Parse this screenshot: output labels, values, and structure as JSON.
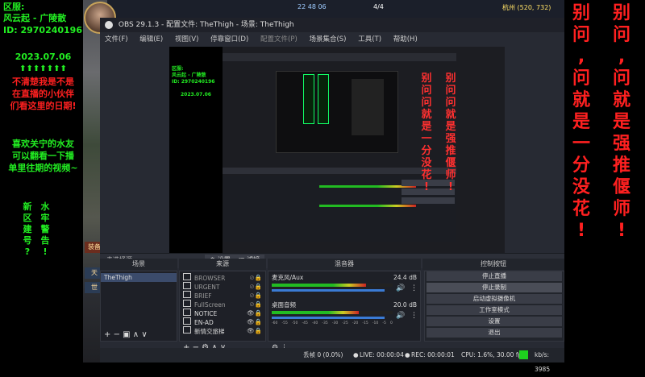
{
  "left_overlay": {
    "line1": "区服:",
    "line2": "风云起 - 广陵散",
    "line3": "ID: 2970240196",
    "date": "2023.07.06",
    "arrows": "⬆⬆⬆⬆⬆⬆⬆",
    "notice": [
      "不清楚我是不是",
      "在直播的小伙伴",
      "们看这里的日期!"
    ],
    "promo": [
      "喜欢关宁的水友",
      "可以翻看一下播",
      "单里往期的视频~"
    ],
    "vcol1": [
      "新",
      "区",
      "建",
      "号",
      "?"
    ],
    "vcol2": [
      "水",
      "牢",
      "警",
      "告",
      "!"
    ]
  },
  "game_top": {
    "time": "22 48 06",
    "count": "4/4",
    "location": "杭州 (520, 732)"
  },
  "obs": {
    "title": "OBS 29.1.3 - 配置文件: TheThigh - 场景: TheThigh",
    "menu": [
      "文件(F)",
      "编辑(E)",
      "视图(V)",
      "停靠窗口(D)",
      "配置文件(P)",
      "场景集合(S)",
      "工具(T)",
      "帮助(H)"
    ],
    "no_source": "未选择源",
    "props_label": "设置",
    "filters_label": "滤镜",
    "docks": {
      "scenes": "场景",
      "sources": "来源",
      "mixer": "混音器",
      "controls": "控制按钮"
    },
    "scenes": [
      "TheThigh"
    ],
    "sources": [
      "BROWSER",
      "URGENT",
      "BRIEF",
      "FullScreen",
      "NOTICE",
      "EN-AD",
      "新情交旅梯"
    ],
    "mixer": [
      {
        "name": "麦克风/Aux",
        "db": "24.4 dB",
        "level": 0.78
      },
      {
        "name": "桌面音频",
        "db": "20.0 dB",
        "level": 0.72
      }
    ],
    "mixer_scale": [
      "-60",
      "-55",
      "-50",
      "-45",
      "-40",
      "-35",
      "-30",
      "-25",
      "-20",
      "-15",
      "-10",
      "-5",
      "0"
    ],
    "controls": [
      "停止直播",
      "停止录制",
      "启动虚拟摄像机",
      "工作室模式",
      "设置",
      "退出"
    ],
    "status": {
      "dropped": "丢帧 0 (0.0%)",
      "live": "LIVE: 00:00:04",
      "rec": "REC: 00:00:01",
      "cpu": "CPU: 1.6%, 30.00 fps",
      "kbps": "kb/s: 3985"
    }
  },
  "game_side_labels": [
    "装备",
    "天",
    "世"
  ],
  "right_overlay": {
    "col1": [
      "别",
      "问",
      ",",
      "问",
      "就",
      "是",
      "一",
      "分",
      "没",
      "花",
      "!"
    ],
    "col2": [
      "别",
      "问",
      ",",
      "问",
      "就",
      "是",
      "强",
      "推",
      "偃",
      "师",
      "!"
    ]
  },
  "nested": {
    "left_lines": [
      "区服:",
      "风云起 - 广陵散",
      "ID: 2970240196",
      "2023.07.06"
    ],
    "red_col1": [
      "别",
      "问",
      "问",
      "就",
      "是",
      "一",
      "分",
      "没",
      "花",
      "!"
    ],
    "red_col2": [
      "别",
      "问",
      "问",
      "就",
      "是",
      "强",
      "推",
      "偃",
      "师",
      "!"
    ]
  }
}
